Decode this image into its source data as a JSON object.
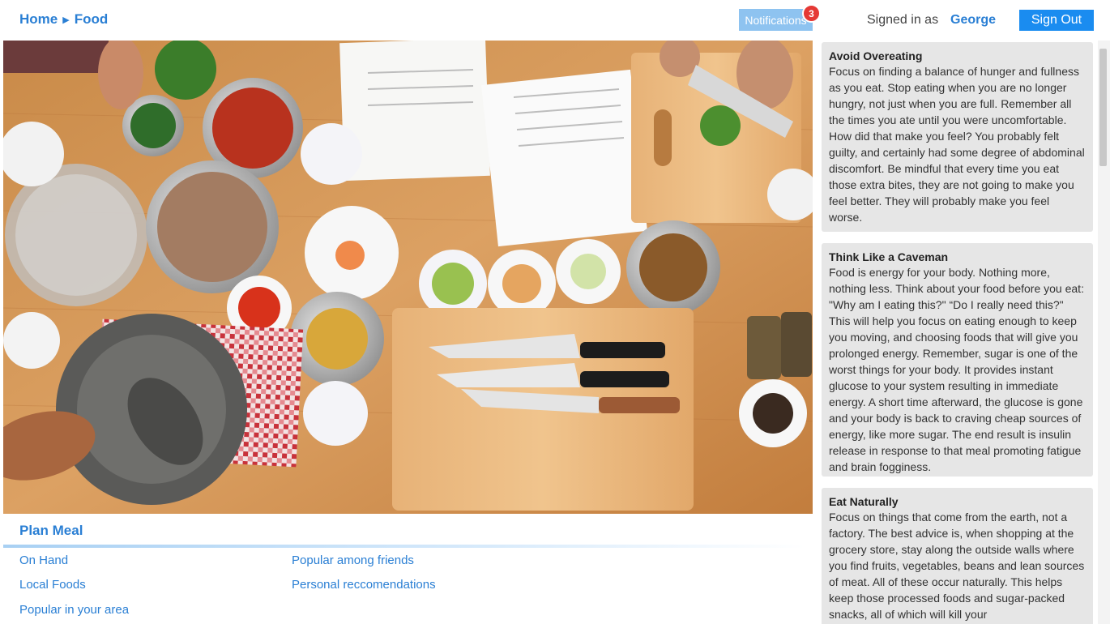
{
  "header": {
    "breadcrumb": [
      "Home",
      "Food"
    ],
    "notifications_label": "Notifications",
    "notifications_count": "3",
    "signed_in_label": "Signed in as",
    "username": "George",
    "sign_out_label": "Sign Out"
  },
  "plan_meal": {
    "title": "Plan Meal",
    "links": [
      "On Hand",
      "Popular among friends",
      "Local Foods",
      "Personal reccomendations",
      "Popular in your area"
    ]
  },
  "tips": [
    {
      "title": "Avoid Overeating",
      "body": "Focus on finding a balance of hunger and fullness as you eat. Stop eating when you are no longer hungry, not just when you are full. Remember all the times you ate until you were uncomfortable. How did that make you feel? You probably felt guilty, and certainly had some degree of abdominal discomfort. Be mindful that every time you eat those extra bites, they are not going to make you feel better. They will probably make you feel worse."
    },
    {
      "title": "Think Like a Caveman",
      "body": "Food is energy for your body. Nothing more, nothing less. Think about your food before you eat: \"Why am I eating this?\" “Do I really need this?\" This will help you focus on eating enough to keep you moving, and choosing foods that will give you prolonged energy.  Remember, sugar is one of the worst things for your body. It provides instant glucose to your system resulting in immediate energy. A short time afterward, the glucose is gone and your body is back to craving cheap sources of energy, like more sugar. The end result is insulin release in response to that meal promoting fatigue and brain fogginess."
    },
    {
      "title": "Eat Naturally",
      "body": "Focus on things that come from the earth, not a factory. The best advice is, when shopping at the grocery store, stay along the outside walls where you find fruits, vegetables, beans and lean sources of meat. All of these occur naturally. This helps keep those processed foods and sugar-packed snacks, all of which will kill your"
    }
  ],
  "colors": {
    "accent": "#2a7fd4",
    "button": "#1a8cf0",
    "badge": "#e53935",
    "card_bg": "#e6e6e6"
  }
}
